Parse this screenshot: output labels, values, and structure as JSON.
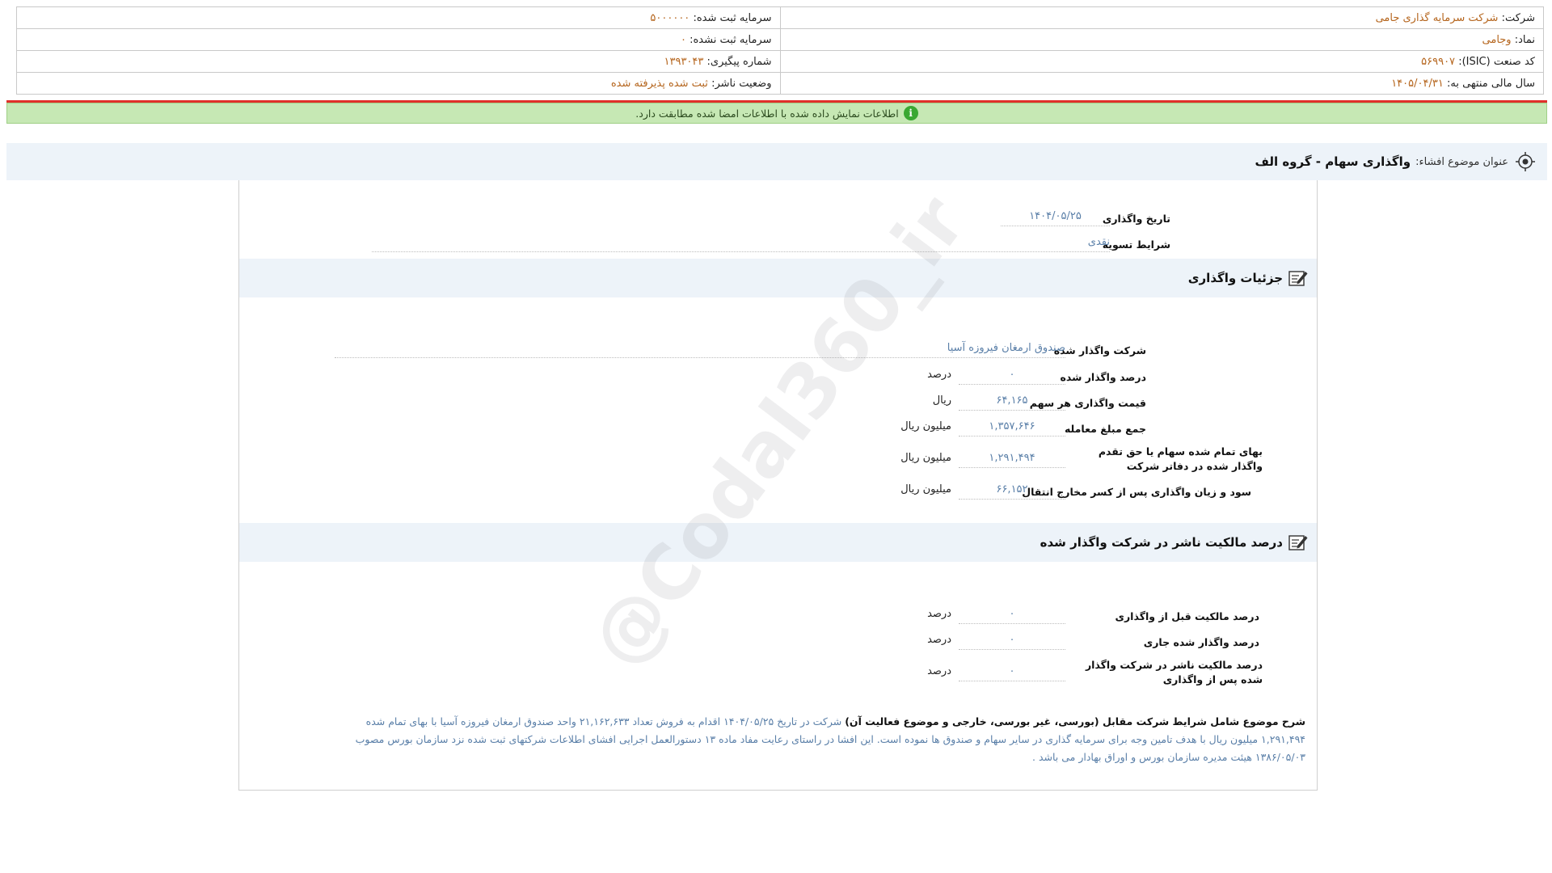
{
  "company_info": {
    "company_label": "شرکت:",
    "company_value": "شرکت سرمایه گذاری جامی",
    "registered_capital_label": "سرمایه ثبت شده:",
    "registered_capital_value": "۵۰۰۰۰۰۰",
    "symbol_label": "نماد:",
    "symbol_value": "وجامی",
    "unregistered_capital_label": "سرمایه ثبت نشده:",
    "unregistered_capital_value": "۰",
    "isic_label": "کد صنعت (ISIC):",
    "isic_value": "۵۶۹۹۰۷",
    "tracking_label": "شماره پیگیری:",
    "tracking_value": "۱۳۹۳۰۴۳",
    "fiscal_year_label": "سال مالی منتهی به:",
    "fiscal_year_value": "۱۴۰۵/۰۴/۳۱",
    "publisher_status_label": "وضعیت ناشر:",
    "publisher_status_value": "ثبت شده پذیرفته شده"
  },
  "notice": {
    "text": "اطلاعات نمایش داده شده با اطلاعات امضا شده مطابقت دارد."
  },
  "disclosure": {
    "subject_label": "عنوان موضوع افشاء:",
    "subject_value": "واگذاری سهام - گروه الف"
  },
  "transfer": {
    "date_label": "تاریخ واگذاری",
    "date_value": "۱۴۰۴/۰۵/۲۵",
    "settlement_label": "شرایط تسویه",
    "settlement_value": "نقدی"
  },
  "details_section": {
    "title": "جزئیات واگذاری",
    "company_label": "شرکت واگذار شده",
    "company_value": "صندوق ارمغان فیروزه آسیا",
    "percent_label": "درصد واگذار شده",
    "percent_value": "۰",
    "percent_unit": "درصد",
    "price_label": "قیمت واگذاری هر سهم",
    "price_value": "۶۴,۱۶۵",
    "price_unit": "ریال",
    "total_label": "جمع مبلغ معامله",
    "total_value": "۱,۳۵۷,۶۴۶",
    "total_unit": "میلیون ریال",
    "book_value_label": "بهای تمام شده سهام یا حق تقدم واگذار شده در دفاتر شرکت",
    "book_value_value": "۱,۲۹۱,۴۹۴",
    "book_value_unit": "میلیون ریال",
    "profit_label": "سود و زیان واگذاری پس از کسر مخارج انتقال",
    "profit_value": "۶۶,۱۵۲",
    "profit_unit": "میلیون ریال"
  },
  "ownership_section": {
    "title": "درصد مالکیت ناشر در شرکت واگذار شده",
    "before_label": "درصد مالکیت قبل از واگذاری",
    "before_value": "۰",
    "before_unit": "درصد",
    "current_label": "درصد واگذار شده جاری",
    "current_value": "۰",
    "current_unit": "درصد",
    "after_label": "درصد مالکیت ناشر در شرکت واگذار شده پس از واگذاری",
    "after_value": "۰",
    "after_unit": "درصد"
  },
  "description": {
    "label": "شرح موضوع شامل شرایط شرکت مقابل (بورسی، غیر بورسی، خارجی و موضوع فعالیت آن)",
    "text": "شرکت در تاریخ ۱۴۰۴/۰۵/۲۵ اقدام به فروش تعداد ۲۱,۱۶۲,۶۳۳ واحد صندوق ارمغان فیروزه آسیا با بهای تمام شده ۱,۲۹۱,۴۹۴ میلیون ریال با هدف تامین وجه برای سرمایه گذاری در سایر سهام و صندوق ها نموده است. این افشا در راستای رعایت مفاد ماده ۱۳ دستورالعمل اجرایی افشای اطلاعات شرکتهای ثبت شده نزد سازمان بورس مصوب ۱۳۸۶/۰۵/۰۳ هیئت مدیره سازمان بورس و اوراق بهادار می باشد ."
  },
  "watermark": {
    "text": "@Codal360_ir"
  }
}
